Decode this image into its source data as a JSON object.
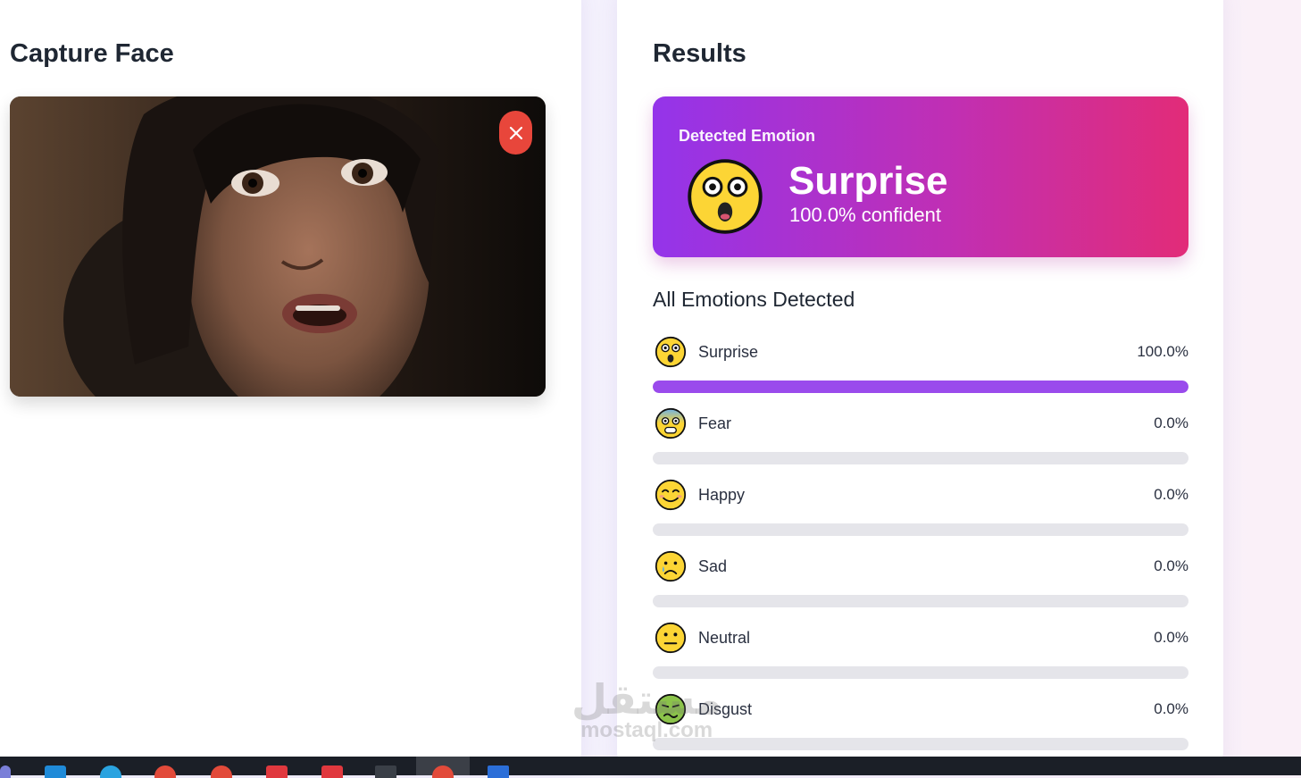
{
  "capture": {
    "title": "Capture Face"
  },
  "results": {
    "title": "Results",
    "detected_label": "Detected Emotion",
    "emotion": "Surprise",
    "confidence": "100.0% confident",
    "all_title": "All Emotions Detected",
    "emotions": [
      {
        "label": "Surprise",
        "percent": "100.0%",
        "value": 100.0
      },
      {
        "label": "Fear",
        "percent": "0.0%",
        "value": 0.0
      },
      {
        "label": "Happy",
        "percent": "0.0%",
        "value": 0.0
      },
      {
        "label": "Sad",
        "percent": "0.0%",
        "value": 0.0
      },
      {
        "label": "Neutral",
        "percent": "0.0%",
        "value": 0.0
      },
      {
        "label": "Disgust",
        "percent": "0.0%",
        "value": 0.0
      }
    ]
  },
  "watermark": {
    "arabic": "مستقل",
    "latin": "mostaql.com"
  },
  "colors": {
    "accent": "#9a4bec",
    "close": "#e8463b",
    "gradient_start": "#9434ea",
    "gradient_end": "#e22c78"
  }
}
